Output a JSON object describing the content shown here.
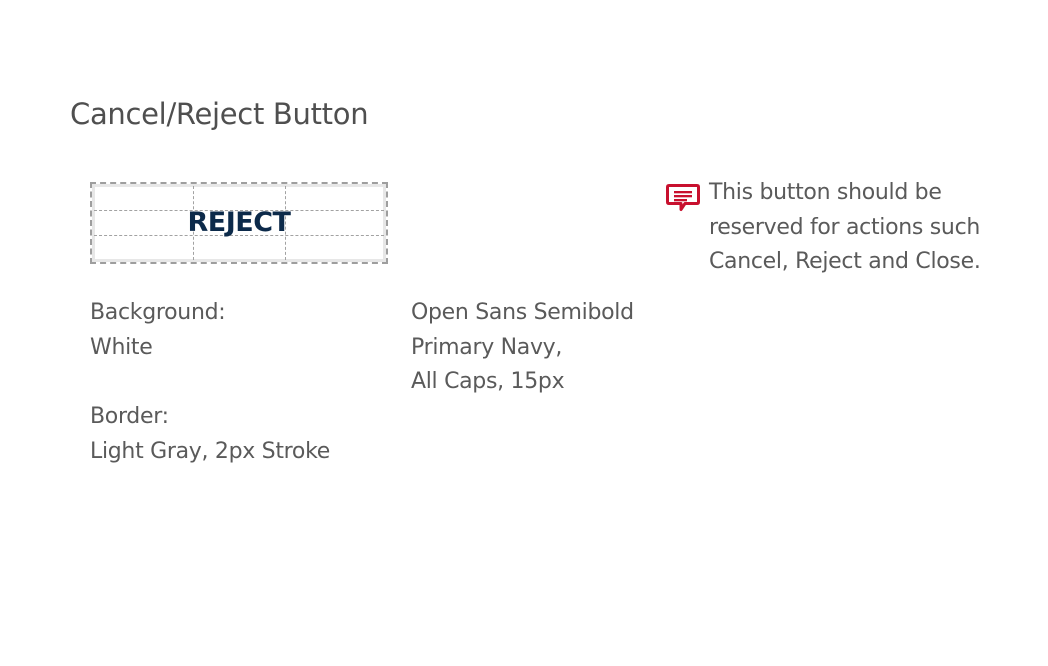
{
  "page": {
    "title": "Cancel/Reject Button"
  },
  "demo_button": {
    "label": "REJECT"
  },
  "specs": {
    "background_label": "Background:",
    "background_value": "White",
    "border_label": "Border:",
    "border_value": "Light Gray, 2px Stroke",
    "font_line1": "Open Sans Semibold",
    "font_line2": "Primary Navy,",
    "font_line3": "All Caps, 15px"
  },
  "note": {
    "icon": "comment-icon",
    "line1": "This button should be",
    "line2": "reserved for actions such",
    "line3": "Cancel, Reject and Close."
  },
  "colors": {
    "navy": "#0c2a4a",
    "note_icon_red": "#c8102e",
    "border_gray": "#9e9e9e",
    "text_gray": "#5a5a5a"
  }
}
